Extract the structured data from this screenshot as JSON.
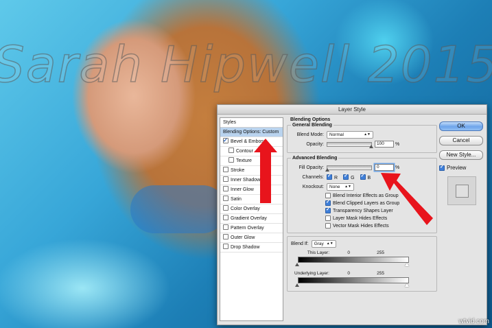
{
  "watermark": "Sarah Hipwell 2015",
  "site_badge": "wtvid.com",
  "dialog": {
    "title": "Layer Style",
    "styles_list": [
      {
        "label": "Styles",
        "header": true
      },
      {
        "label": "Blending Options: Custom",
        "selected": true
      },
      {
        "label": "Bevel & Emboss",
        "checked": true
      },
      {
        "label": "Contour",
        "checked": false,
        "sub": true
      },
      {
        "label": "Texture",
        "checked": false,
        "sub": true
      },
      {
        "label": "Stroke",
        "checked": false
      },
      {
        "label": "Inner Shadow",
        "checked": false
      },
      {
        "label": "Inner Glow",
        "checked": false
      },
      {
        "label": "Satin",
        "checked": false
      },
      {
        "label": "Color Overlay",
        "checked": false
      },
      {
        "label": "Gradient Overlay",
        "checked": false
      },
      {
        "label": "Pattern Overlay",
        "checked": false
      },
      {
        "label": "Outer Glow",
        "checked": false
      },
      {
        "label": "Drop Shadow",
        "checked": false
      }
    ],
    "blending_options_title": "Blending Options",
    "general_blending": {
      "legend": "General Blending",
      "blend_mode_label": "Blend Mode:",
      "blend_mode_value": "Normal",
      "opacity_label": "Opacity:",
      "opacity_value": "100",
      "opacity_fraction": 1.0,
      "percent": "%"
    },
    "advanced_blending": {
      "legend": "Advanced Blending",
      "fill_opacity_label": "Fill Opacity:",
      "fill_opacity_value": "0",
      "fill_opacity_fraction": 0.0,
      "percent": "%",
      "channels_label": "Channels:",
      "channels": [
        "R",
        "G",
        "B"
      ],
      "knockout_label": "Knockout:",
      "knockout_value": "None",
      "options": [
        {
          "label": "Blend Interior Effects as Group",
          "checked": false
        },
        {
          "label": "Blend Clipped Layers as Group",
          "checked": true
        },
        {
          "label": "Transparency Shapes Layer",
          "checked": true
        },
        {
          "label": "Layer Mask Hides Effects",
          "checked": false
        },
        {
          "label": "Vector Mask Hides Effects",
          "checked": false
        }
      ]
    },
    "blend_if": {
      "label": "Blend If:",
      "value": "Gray",
      "this_layer_label": "This Layer:",
      "this_layer_min": "0",
      "this_layer_max": "255",
      "underlying_label": "Underlying Layer:",
      "underlying_min": "0",
      "underlying_max": "255"
    },
    "buttons": {
      "ok": "OK",
      "cancel": "Cancel",
      "new_style": "New Style...",
      "preview_label": "Preview"
    }
  },
  "colors": {
    "annotation_arrow": "#e8141c",
    "selected_row": "#b9d3ee",
    "default_button": "#6ea4ea"
  }
}
